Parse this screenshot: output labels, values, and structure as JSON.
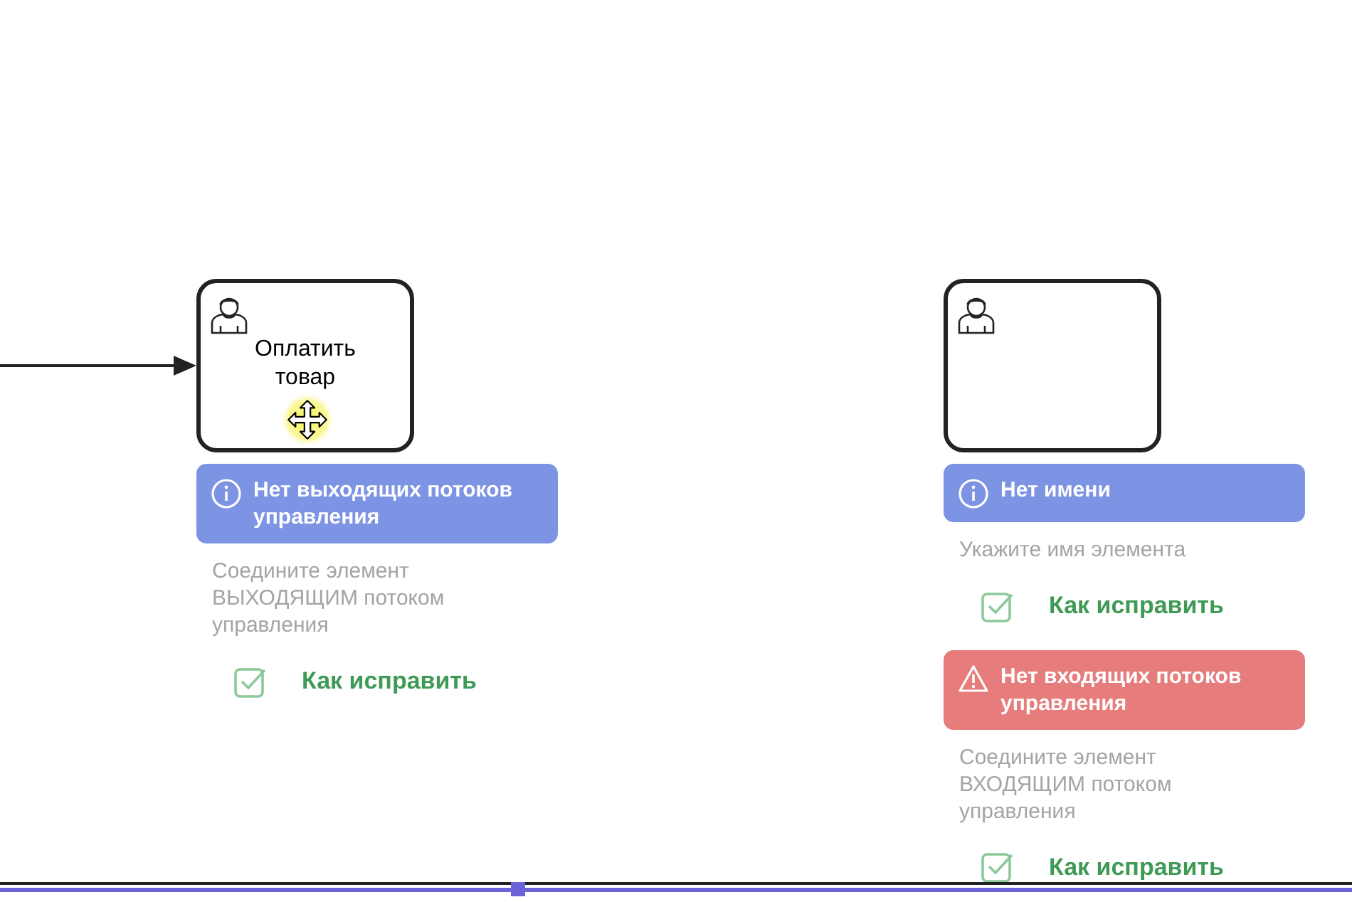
{
  "tasks": [
    {
      "label": "Оплатить товар",
      "incoming": true,
      "dragging": true,
      "issues": [
        {
          "kind": "info",
          "title": "Нет выходящих потоков управления",
          "hint": "Соедините элемент ВЫХОДЯЩИМ потоком управления",
          "fix": "Как исправить"
        }
      ]
    },
    {
      "incoming": false,
      "dragging": false,
      "issues": [
        {
          "kind": "info",
          "title": "Нет имени",
          "hint": "Укажите имя элемента",
          "fix": "Как исправить"
        },
        {
          "kind": "error",
          "title": "Нет входящих потоков управления",
          "hint": "Соедините элемент ВХОДЯЩИМ потоком управления",
          "fix": "Как исправить"
        }
      ]
    }
  ]
}
